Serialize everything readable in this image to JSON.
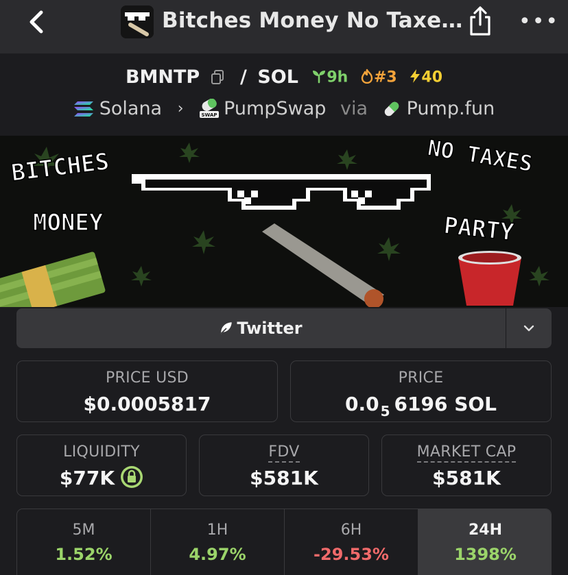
{
  "topbar": {
    "title": "Bitches Money No Taxe…",
    "more_label": "•••",
    "icons": {
      "back": "chevron-left-icon",
      "share": "share-icon",
      "more": "more-horizontal-icon"
    }
  },
  "pair": {
    "base": "BMNTP",
    "separator": "/",
    "quote": "SOL",
    "age": "9h",
    "rank": "#3",
    "boosts": "40"
  },
  "chain": {
    "network": "Solana",
    "dex": "PumpSwap",
    "dex_badge": "SWAP",
    "via_label": "via",
    "launchpad": "Pump.fun"
  },
  "banner": {
    "text_left_top": "BITCHES",
    "text_left_bottom": "MONEY",
    "text_right_top": "NO TAXES",
    "text_right_bottom": "PARTY"
  },
  "social": {
    "twitter_label": "Twitter"
  },
  "stats": {
    "price_usd": {
      "label": "PRICE USD",
      "value": "$0.0005817"
    },
    "price_native": {
      "label": "PRICE",
      "value_prefix": "0.0",
      "zeros_count": "5",
      "value_suffix": "6196 SOL"
    },
    "liquidity": {
      "label": "LIQUIDITY",
      "value": "$77K"
    },
    "fdv": {
      "label": "FDV",
      "value": "$581K"
    },
    "market_cap": {
      "label": "MARKET CAP",
      "value": "$581K"
    }
  },
  "changes": [
    {
      "label": "5M",
      "value": "1.52%",
      "color": "#9bd46a"
    },
    {
      "label": "1H",
      "value": "4.97%",
      "color": "#9bd46a"
    },
    {
      "label": "6H",
      "value": "-29.53%",
      "color": "#f06a6a"
    },
    {
      "label": "24H",
      "value": "1398%",
      "color": "#9bd46a"
    }
  ],
  "colors": {
    "positive": "#9bd46a",
    "negative": "#f06a6a",
    "age": "#7fd06b",
    "rank": "#f3a33b",
    "boost": "#f5cf33"
  }
}
